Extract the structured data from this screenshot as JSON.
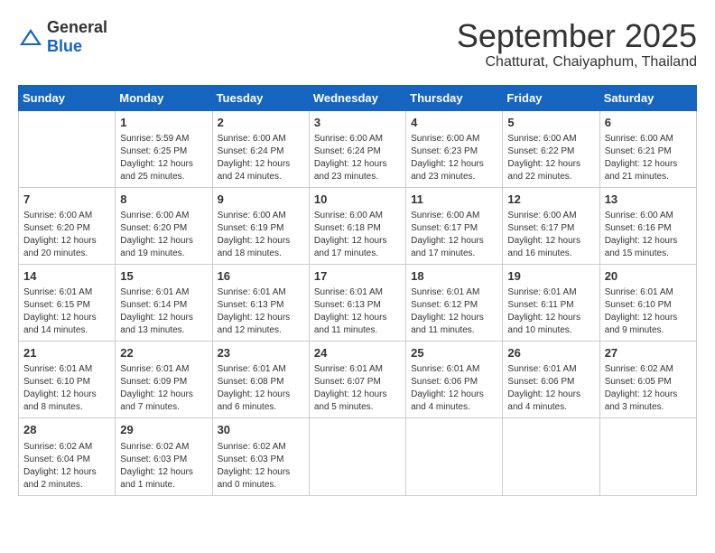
{
  "header": {
    "logo": {
      "general": "General",
      "blue": "Blue"
    },
    "title": "September 2025",
    "location": "Chatturat, Chaiyaphum, Thailand"
  },
  "weekdays": [
    "Sunday",
    "Monday",
    "Tuesday",
    "Wednesday",
    "Thursday",
    "Friday",
    "Saturday"
  ],
  "weeks": [
    [
      {
        "day": null,
        "sunrise": null,
        "sunset": null,
        "daylight": null
      },
      {
        "day": "1",
        "sunrise": "Sunrise: 5:59 AM",
        "sunset": "Sunset: 6:25 PM",
        "daylight": "Daylight: 12 hours and 25 minutes."
      },
      {
        "day": "2",
        "sunrise": "Sunrise: 6:00 AM",
        "sunset": "Sunset: 6:24 PM",
        "daylight": "Daylight: 12 hours and 24 minutes."
      },
      {
        "day": "3",
        "sunrise": "Sunrise: 6:00 AM",
        "sunset": "Sunset: 6:24 PM",
        "daylight": "Daylight: 12 hours and 23 minutes."
      },
      {
        "day": "4",
        "sunrise": "Sunrise: 6:00 AM",
        "sunset": "Sunset: 6:23 PM",
        "daylight": "Daylight: 12 hours and 23 minutes."
      },
      {
        "day": "5",
        "sunrise": "Sunrise: 6:00 AM",
        "sunset": "Sunset: 6:22 PM",
        "daylight": "Daylight: 12 hours and 22 minutes."
      },
      {
        "day": "6",
        "sunrise": "Sunrise: 6:00 AM",
        "sunset": "Sunset: 6:21 PM",
        "daylight": "Daylight: 12 hours and 21 minutes."
      }
    ],
    [
      {
        "day": "7",
        "sunrise": "Sunrise: 6:00 AM",
        "sunset": "Sunset: 6:20 PM",
        "daylight": "Daylight: 12 hours and 20 minutes."
      },
      {
        "day": "8",
        "sunrise": "Sunrise: 6:00 AM",
        "sunset": "Sunset: 6:20 PM",
        "daylight": "Daylight: 12 hours and 19 minutes."
      },
      {
        "day": "9",
        "sunrise": "Sunrise: 6:00 AM",
        "sunset": "Sunset: 6:19 PM",
        "daylight": "Daylight: 12 hours and 18 minutes."
      },
      {
        "day": "10",
        "sunrise": "Sunrise: 6:00 AM",
        "sunset": "Sunset: 6:18 PM",
        "daylight": "Daylight: 12 hours and 17 minutes."
      },
      {
        "day": "11",
        "sunrise": "Sunrise: 6:00 AM",
        "sunset": "Sunset: 6:17 PM",
        "daylight": "Daylight: 12 hours and 17 minutes."
      },
      {
        "day": "12",
        "sunrise": "Sunrise: 6:00 AM",
        "sunset": "Sunset: 6:17 PM",
        "daylight": "Daylight: 12 hours and 16 minutes."
      },
      {
        "day": "13",
        "sunrise": "Sunrise: 6:00 AM",
        "sunset": "Sunset: 6:16 PM",
        "daylight": "Daylight: 12 hours and 15 minutes."
      }
    ],
    [
      {
        "day": "14",
        "sunrise": "Sunrise: 6:01 AM",
        "sunset": "Sunset: 6:15 PM",
        "daylight": "Daylight: 12 hours and 14 minutes."
      },
      {
        "day": "15",
        "sunrise": "Sunrise: 6:01 AM",
        "sunset": "Sunset: 6:14 PM",
        "daylight": "Daylight: 12 hours and 13 minutes."
      },
      {
        "day": "16",
        "sunrise": "Sunrise: 6:01 AM",
        "sunset": "Sunset: 6:13 PM",
        "daylight": "Daylight: 12 hours and 12 minutes."
      },
      {
        "day": "17",
        "sunrise": "Sunrise: 6:01 AM",
        "sunset": "Sunset: 6:13 PM",
        "daylight": "Daylight: 12 hours and 11 minutes."
      },
      {
        "day": "18",
        "sunrise": "Sunrise: 6:01 AM",
        "sunset": "Sunset: 6:12 PM",
        "daylight": "Daylight: 12 hours and 11 minutes."
      },
      {
        "day": "19",
        "sunrise": "Sunrise: 6:01 AM",
        "sunset": "Sunset: 6:11 PM",
        "daylight": "Daylight: 12 hours and 10 minutes."
      },
      {
        "day": "20",
        "sunrise": "Sunrise: 6:01 AM",
        "sunset": "Sunset: 6:10 PM",
        "daylight": "Daylight: 12 hours and 9 minutes."
      }
    ],
    [
      {
        "day": "21",
        "sunrise": "Sunrise: 6:01 AM",
        "sunset": "Sunset: 6:10 PM",
        "daylight": "Daylight: 12 hours and 8 minutes."
      },
      {
        "day": "22",
        "sunrise": "Sunrise: 6:01 AM",
        "sunset": "Sunset: 6:09 PM",
        "daylight": "Daylight: 12 hours and 7 minutes."
      },
      {
        "day": "23",
        "sunrise": "Sunrise: 6:01 AM",
        "sunset": "Sunset: 6:08 PM",
        "daylight": "Daylight: 12 hours and 6 minutes."
      },
      {
        "day": "24",
        "sunrise": "Sunrise: 6:01 AM",
        "sunset": "Sunset: 6:07 PM",
        "daylight": "Daylight: 12 hours and 5 minutes."
      },
      {
        "day": "25",
        "sunrise": "Sunrise: 6:01 AM",
        "sunset": "Sunset: 6:06 PM",
        "daylight": "Daylight: 12 hours and 4 minutes."
      },
      {
        "day": "26",
        "sunrise": "Sunrise: 6:01 AM",
        "sunset": "Sunset: 6:06 PM",
        "daylight": "Daylight: 12 hours and 4 minutes."
      },
      {
        "day": "27",
        "sunrise": "Sunrise: 6:02 AM",
        "sunset": "Sunset: 6:05 PM",
        "daylight": "Daylight: 12 hours and 3 minutes."
      }
    ],
    [
      {
        "day": "28",
        "sunrise": "Sunrise: 6:02 AM",
        "sunset": "Sunset: 6:04 PM",
        "daylight": "Daylight: 12 hours and 2 minutes."
      },
      {
        "day": "29",
        "sunrise": "Sunrise: 6:02 AM",
        "sunset": "Sunset: 6:03 PM",
        "daylight": "Daylight: 12 hours and 1 minute."
      },
      {
        "day": "30",
        "sunrise": "Sunrise: 6:02 AM",
        "sunset": "Sunset: 6:03 PM",
        "daylight": "Daylight: 12 hours and 0 minutes."
      },
      {
        "day": null,
        "sunrise": null,
        "sunset": null,
        "daylight": null
      },
      {
        "day": null,
        "sunrise": null,
        "sunset": null,
        "daylight": null
      },
      {
        "day": null,
        "sunrise": null,
        "sunset": null,
        "daylight": null
      },
      {
        "day": null,
        "sunrise": null,
        "sunset": null,
        "daylight": null
      }
    ]
  ]
}
